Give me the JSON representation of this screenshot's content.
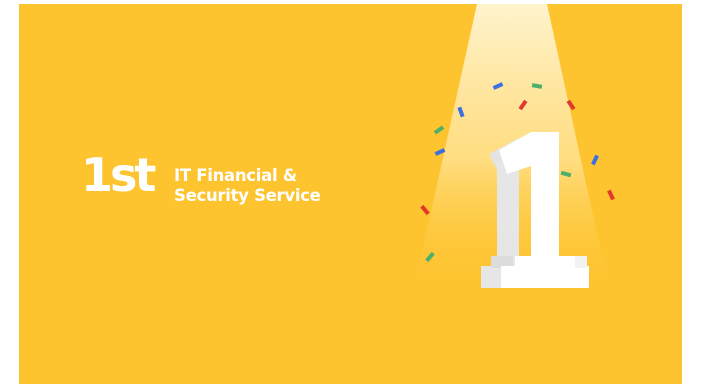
{
  "slide": {
    "rank": "1st",
    "subtitle_line1": "IT Financial &",
    "subtitle_line2": "Security Service",
    "numeral": "1"
  },
  "colors": {
    "background": "#FEC430",
    "text": "#FFFFFF",
    "spotlight": "#FFF3C4",
    "confetti_blue": "#3D6FE0",
    "confetti_green": "#4CAF6A",
    "confetti_red": "#E0392C"
  }
}
